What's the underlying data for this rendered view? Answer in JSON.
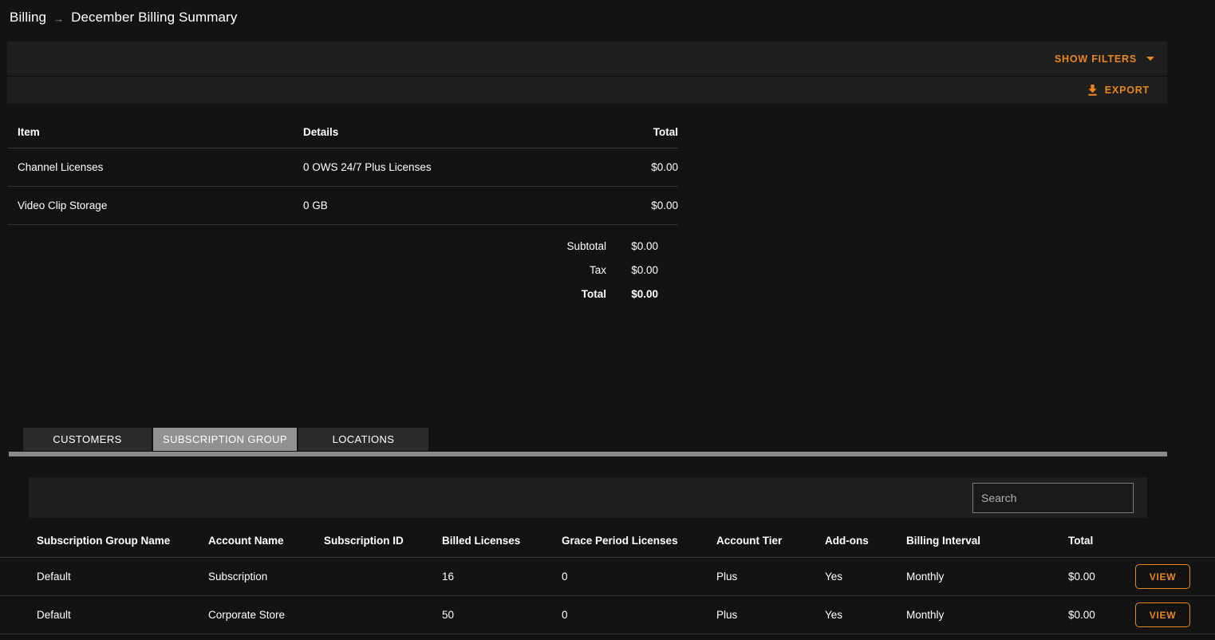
{
  "breadcrumb": {
    "root": "Billing",
    "separator": "→",
    "current": "December Billing Summary"
  },
  "toolbar": {
    "show_filters_label": "SHOW FILTERS",
    "export_label": "EXPORT"
  },
  "summary_table": {
    "headers": {
      "item": "Item",
      "details": "Details",
      "total": "Total"
    },
    "rows": [
      {
        "item": "Channel Licenses",
        "details": "0 OWS 24/7 Plus Licenses",
        "total": "$0.00"
      },
      {
        "item": "Video Clip Storage",
        "details": "0 GB",
        "total": "$0.00"
      }
    ],
    "totals": [
      {
        "label": "Subtotal",
        "value": "$0.00"
      },
      {
        "label": "Tax",
        "value": "$0.00"
      },
      {
        "label": "Total",
        "value": "$0.00"
      }
    ]
  },
  "tabs": [
    {
      "label": "CUSTOMERS",
      "active": false
    },
    {
      "label": "SUBSCRIPTION GROUP",
      "active": true
    },
    {
      "label": "LOCATIONS",
      "active": false
    }
  ],
  "search": {
    "value": "",
    "placeholder": "Search"
  },
  "grid": {
    "headers": [
      "Subscription Group Name",
      "Account Name",
      "Subscription ID",
      "Billed Licenses",
      "Grace Period Licenses",
      "Account Tier",
      "Add-ons",
      "Billing Interval",
      "Total"
    ],
    "rows": [
      {
        "group_name": "Default",
        "account_name": "Subscription",
        "subscription_id": "",
        "billed_licenses": "16",
        "grace_period_licenses": "0",
        "account_tier": "Plus",
        "addons": "Yes",
        "billing_interval": "Monthly",
        "total": "$0.00",
        "action_label": "VIEW"
      },
      {
        "group_name": "Default",
        "account_name": "Corporate Store",
        "subscription_id": "",
        "billed_licenses": "50",
        "grace_period_licenses": "0",
        "account_tier": "Plus",
        "addons": "Yes",
        "billing_interval": "Monthly",
        "total": "$0.00",
        "action_label": "VIEW"
      }
    ]
  },
  "colors": {
    "accent": "#e8871e",
    "page_background": "#131313",
    "panel_background": "#1f1f1f",
    "active_tab": "#919191"
  }
}
